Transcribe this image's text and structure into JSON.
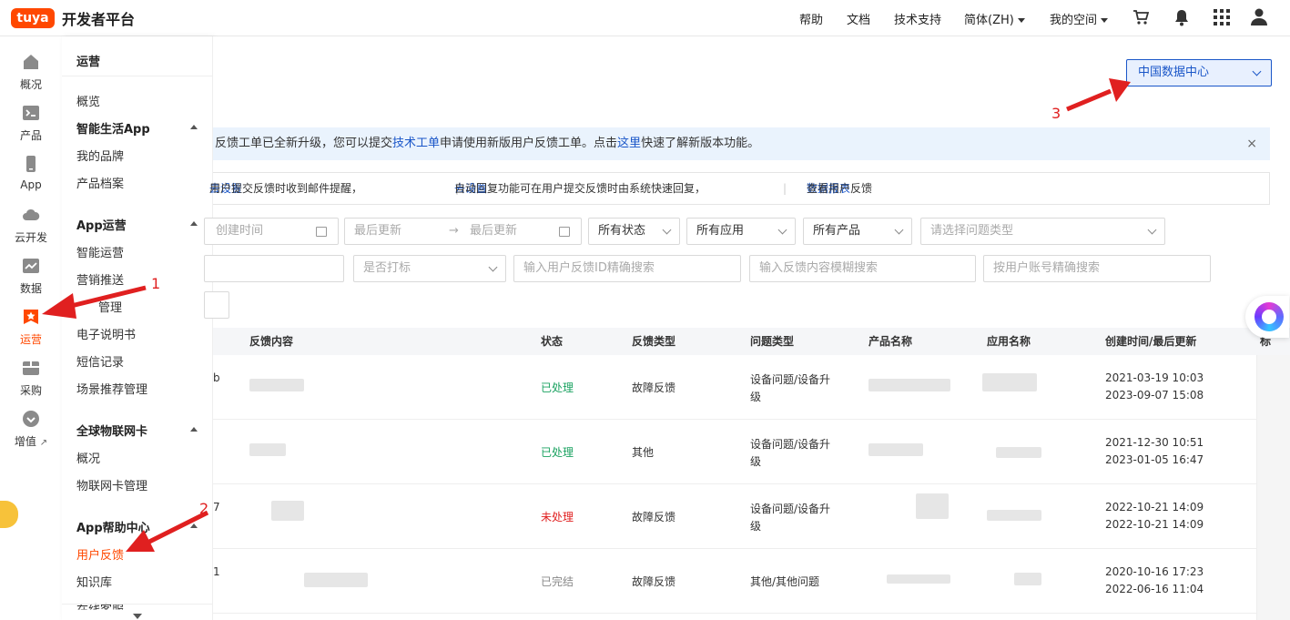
{
  "header": {
    "logo": "tuya",
    "brand": "开发者平台",
    "nav": {
      "help": "帮助",
      "docs": "文档",
      "support": "技术支持",
      "language": "简体(ZH)",
      "my_space": "我的空间"
    }
  },
  "rail": {
    "items": [
      {
        "label": "概况",
        "icon": "home-icon"
      },
      {
        "label": "产品",
        "icon": "terminal-icon"
      },
      {
        "label": "App",
        "icon": "phone-icon"
      },
      {
        "label": "云开发",
        "icon": "cloud-icon"
      },
      {
        "label": "数据",
        "icon": "chart-icon"
      },
      {
        "label": "运营",
        "icon": "star-badge-icon",
        "active": true
      },
      {
        "label": "采购",
        "icon": "box-icon"
      },
      {
        "label": "增值",
        "icon": "heart-icon"
      }
    ]
  },
  "menu": {
    "title": "运营",
    "items": {
      "overview": "概览",
      "smart_app": "智能生活App",
      "my_brand": "我的品牌",
      "product_profile": "产品档案",
      "app_ops": "App运营",
      "smart_ops": "智能运营",
      "marketing_push": "营销推送",
      "manage": "管理",
      "e_manual": "电子说明书",
      "sms_records": "短信记录",
      "scene_rec": "场景推荐管理",
      "global_iot_card": "全球物联网卡",
      "card_overview": "概况",
      "card_manage": "物联网卡管理",
      "app_help": "App帮助中心",
      "user_feedback": "用户反馈",
      "knowledge_base": "知识库",
      "online_support": "在线客服"
    }
  },
  "main": {
    "datacenter": "中国数据中心",
    "notice": {
      "part1": "反馈工单已全新升级，您可以提交",
      "link1": "技术工单",
      "part2": "申请使用新版用户反馈工单。点击",
      "link2": "这里",
      "part3": "快速了解新版本功能。",
      "close": "×"
    },
    "tips": {
      "t1": "用户提交反馈时收到邮件提醒，",
      "t1_link": "去设置",
      "t2": "自动回复功能可在用户提交反馈时由系统快速回复，",
      "t2_link": "去设置",
      "t3": "查看用户反馈",
      "t3_link": "数据报表",
      "sep": "|"
    },
    "filters": {
      "create_time": "创建时间",
      "last_update_from": "最后更新",
      "arrow": "→",
      "last_update_to": "最后更新",
      "status": "所有状态",
      "app": "所有应用",
      "product": "所有产品",
      "issue_type": "请选择问题类型",
      "marked": "是否打标",
      "feedback_id": "输入用户反馈ID精确搜索",
      "content_search": "输入反馈内容模糊搜索",
      "account": "按用户账号精确搜索"
    },
    "table": {
      "headers": [
        "反馈内容",
        "状态",
        "反馈类型",
        "问题类型",
        "产品名称",
        "应用名称",
        "创建时间/最后更新",
        "标"
      ],
      "rows": [
        {
          "left": "b",
          "status": "已处理",
          "type": "故障反馈",
          "issue": [
            "设备问题/设备升",
            "级"
          ],
          "created": "2021-03-19 10:03",
          "updated": "2023-09-07 15:08"
        },
        {
          "left": "",
          "status": "已处理",
          "type": "其他",
          "issue": [
            "设备问题/设备升",
            "级"
          ],
          "created": "2021-12-30 10:51",
          "updated": "2023-01-05 16:47"
        },
        {
          "left": "7",
          "status": "未处理",
          "type": "故障反馈",
          "issue": [
            "设备问题/设备升",
            "级"
          ],
          "created": "2022-10-21 14:09",
          "updated": "2022-10-21 14:09"
        },
        {
          "left": "1",
          "status": "已完结",
          "type": "故障反馈",
          "issue": [
            "其他/其他问题"
          ],
          "created": "2020-10-16 17:23",
          "updated": "2022-06-16 11:04"
        }
      ]
    }
  },
  "annotations": {
    "a1": "1",
    "a2": "2",
    "a3": "3"
  },
  "colors": {
    "brand": "#ff4800",
    "link": "#1a56c8",
    "processed": "#1aa260",
    "unprocessed": "#e02020",
    "annotation": "#e02020"
  }
}
